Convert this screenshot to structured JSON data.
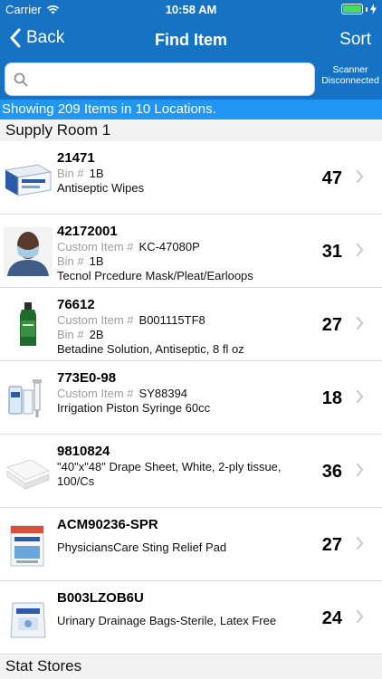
{
  "status_bar": {
    "carrier": "Carrier",
    "time": "10:58 AM"
  },
  "nav": {
    "back_label": "Back",
    "title": "Find Item",
    "sort_label": "Sort"
  },
  "search": {
    "placeholder": "",
    "value": ""
  },
  "scanner": {
    "line1": "Scanner",
    "line2": "Disconnected"
  },
  "summary": "Showing 209 Items in 10 Locations.",
  "colors": {
    "nav_blue": "#1673c4",
    "summary_blue": "#2196f3",
    "battery_green": "#4cd964",
    "label_gray": "#9e9e9e"
  },
  "sections": [
    {
      "title": "Supply Room 1",
      "items": [
        {
          "id": "21471",
          "custom_label": "",
          "custom_value": "",
          "bin_label": "Bin #",
          "bin": "1B",
          "description": "Antiseptic Wipes",
          "qty": "47",
          "thumb": "wipes-box-icon"
        },
        {
          "id": "42172001",
          "custom_label": "Custom Item #",
          "custom_value": "KC-47080P",
          "bin_label": "Bin #",
          "bin": "1B",
          "description": "Tecnol Prcedure Mask/Pleat/Earloops",
          "qty": "31",
          "thumb": "mask-person-icon"
        },
        {
          "id": "76612",
          "custom_label": "Custom Item #",
          "custom_value": "B001115TF8",
          "bin_label": "Bin #",
          "bin": "2B",
          "description": "Betadine Solution, Antiseptic, 8 fl oz",
          "qty": "27",
          "thumb": "bottle-icon"
        },
        {
          "id": "773E0-98",
          "custom_label": "Custom Item #",
          "custom_value": "SY88394",
          "bin_label": "",
          "bin": "",
          "description": "Irrigation Piston Syringe 60cc",
          "qty": "18",
          "thumb": "syringe-icon"
        },
        {
          "id": "9810824",
          "custom_label": "",
          "custom_value": "",
          "bin_label": "",
          "bin": "",
          "description": "\"40\"x\"48\" Drape Sheet, White, 2-ply tissue,",
          "description2": "100/Cs",
          "qty": "36",
          "thumb": "drape-sheet-icon"
        },
        {
          "id": "ACM90236-SPR",
          "custom_label": "",
          "custom_value": "",
          "bin_label": "",
          "bin": "",
          "description": "PhysiciansCare Sting Relief Pad",
          "qty": "27",
          "thumb": "sting-relief-box-icon"
        },
        {
          "id": "B003LZOB6U",
          "custom_label": "",
          "custom_value": "",
          "bin_label": "",
          "bin": "",
          "description": "Urinary Drainage Bags-Sterile, Latex Free",
          "qty": "24",
          "thumb": "drainage-bag-icon"
        }
      ]
    },
    {
      "title": "Stat Stores",
      "items": []
    }
  ]
}
